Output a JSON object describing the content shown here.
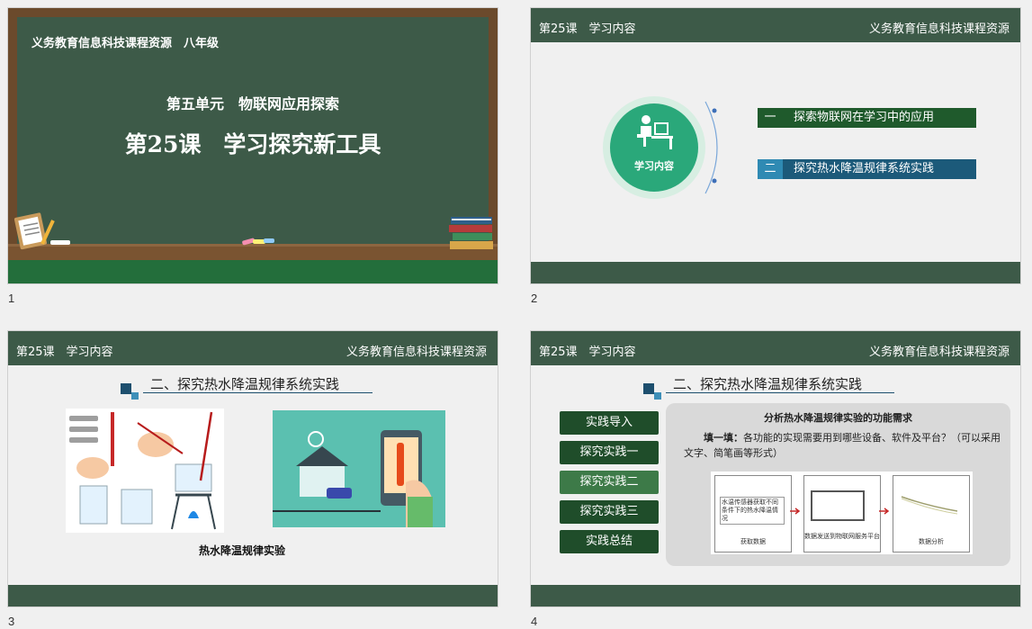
{
  "slides": [
    {
      "number": "1",
      "top_line": "义务教育信息科技课程资源　八年级",
      "unit_title": "第五单元　物联网应用探索",
      "lesson_title": "第25课　学习探究新工具"
    },
    {
      "number": "2",
      "header_left": "第25课　学习内容",
      "header_right": "义务教育信息科技课程资源",
      "center_label": "学习内容",
      "items": [
        {
          "num": "一",
          "label": "探索物联网在学习中的应用"
        },
        {
          "num": "二",
          "label": "探究热水降温规律系统实践"
        }
      ]
    },
    {
      "number": "3",
      "header_left": "第25课　学习内容",
      "header_right": "义务教育信息科技课程资源",
      "section_title": "二、探究热水降温规律系统实践",
      "caption": "热水降温规律实验"
    },
    {
      "number": "4",
      "header_left": "第25课　学习内容",
      "header_right": "义务教育信息科技课程资源",
      "section_title": "二、探究热水降温规律系统实践",
      "menu": [
        "实践导入",
        "探究实践一",
        "探究实践二",
        "探究实践三",
        "实践总结"
      ],
      "panel_title": "分析热水降温规律实验的功能需求",
      "fill_label": "填一填：",
      "fill_text": "各功能的实现需要用到哪些设备、软件及平台？（可以采用文字、简笔画等形式）",
      "diagram": {
        "sensor_text": "水温传感器获取不同条件下的热水降温情况",
        "step1": "获取数据",
        "step2": "数据发送到物联网服务平台",
        "step3": "数据分析"
      }
    }
  ],
  "colors": {
    "header": "#3d5a48",
    "board": "#3d5a48",
    "accent_green": "#2aa87a",
    "tag_dark_green": "#1f5a2c",
    "tag_blue": "#1c5a7a"
  }
}
